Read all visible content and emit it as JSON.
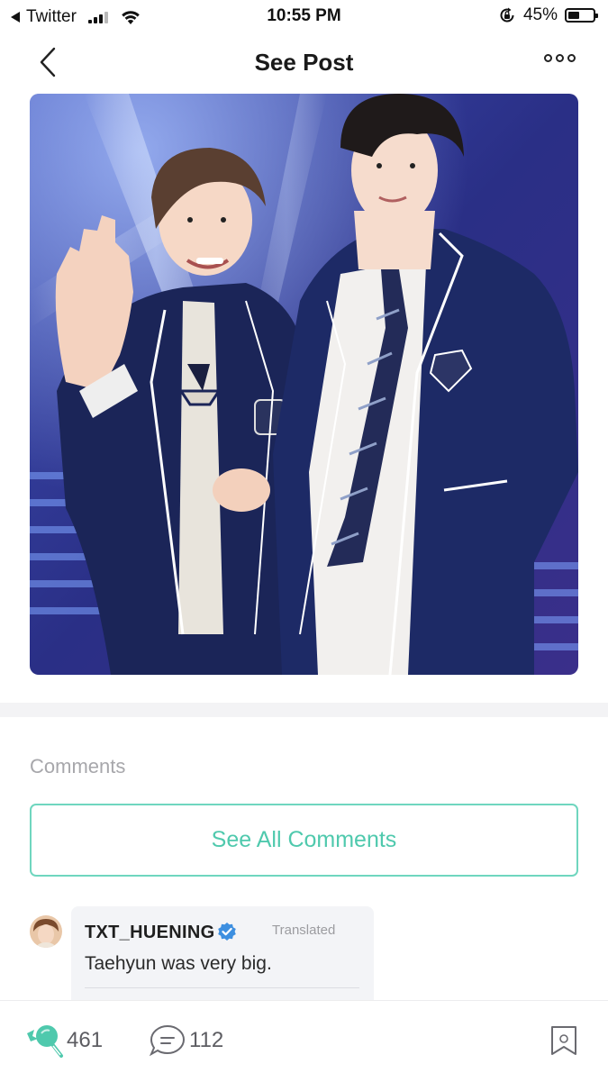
{
  "status_bar": {
    "back_app": "Twitter",
    "time": "10:55 PM",
    "battery_percent": "45%",
    "battery_level": 0.45,
    "icons": [
      "back-triangle-icon",
      "signal-icon",
      "wifi-icon",
      "rotation-lock-icon",
      "battery-icon"
    ]
  },
  "header": {
    "title": "See Post",
    "back_icon": "chevron-left-icon",
    "more_icon": "more-dots-icon"
  },
  "post": {
    "image_alt": "Two performers in navy school-uniform blazers on stage, one waving"
  },
  "comments": {
    "section_label": "Comments",
    "see_all_label": "See All Comments",
    "items": [
      {
        "author": "TXT_HUENING",
        "verified": true,
        "translated_label": "Translated",
        "text": "Taehyun was very big."
      }
    ]
  },
  "bottom_bar": {
    "like_count": "461",
    "comment_count": "112",
    "icons": [
      "like-lollipop-icon",
      "comment-bubble-icon",
      "bookmark-icon"
    ]
  },
  "colors": {
    "accent": "#4fc9ad",
    "accent_border": "#6fd6bf",
    "verified_blue": "#3d8fe0",
    "muted_text": "#a7a7ab",
    "blazer_navy": "#1d2a66"
  }
}
